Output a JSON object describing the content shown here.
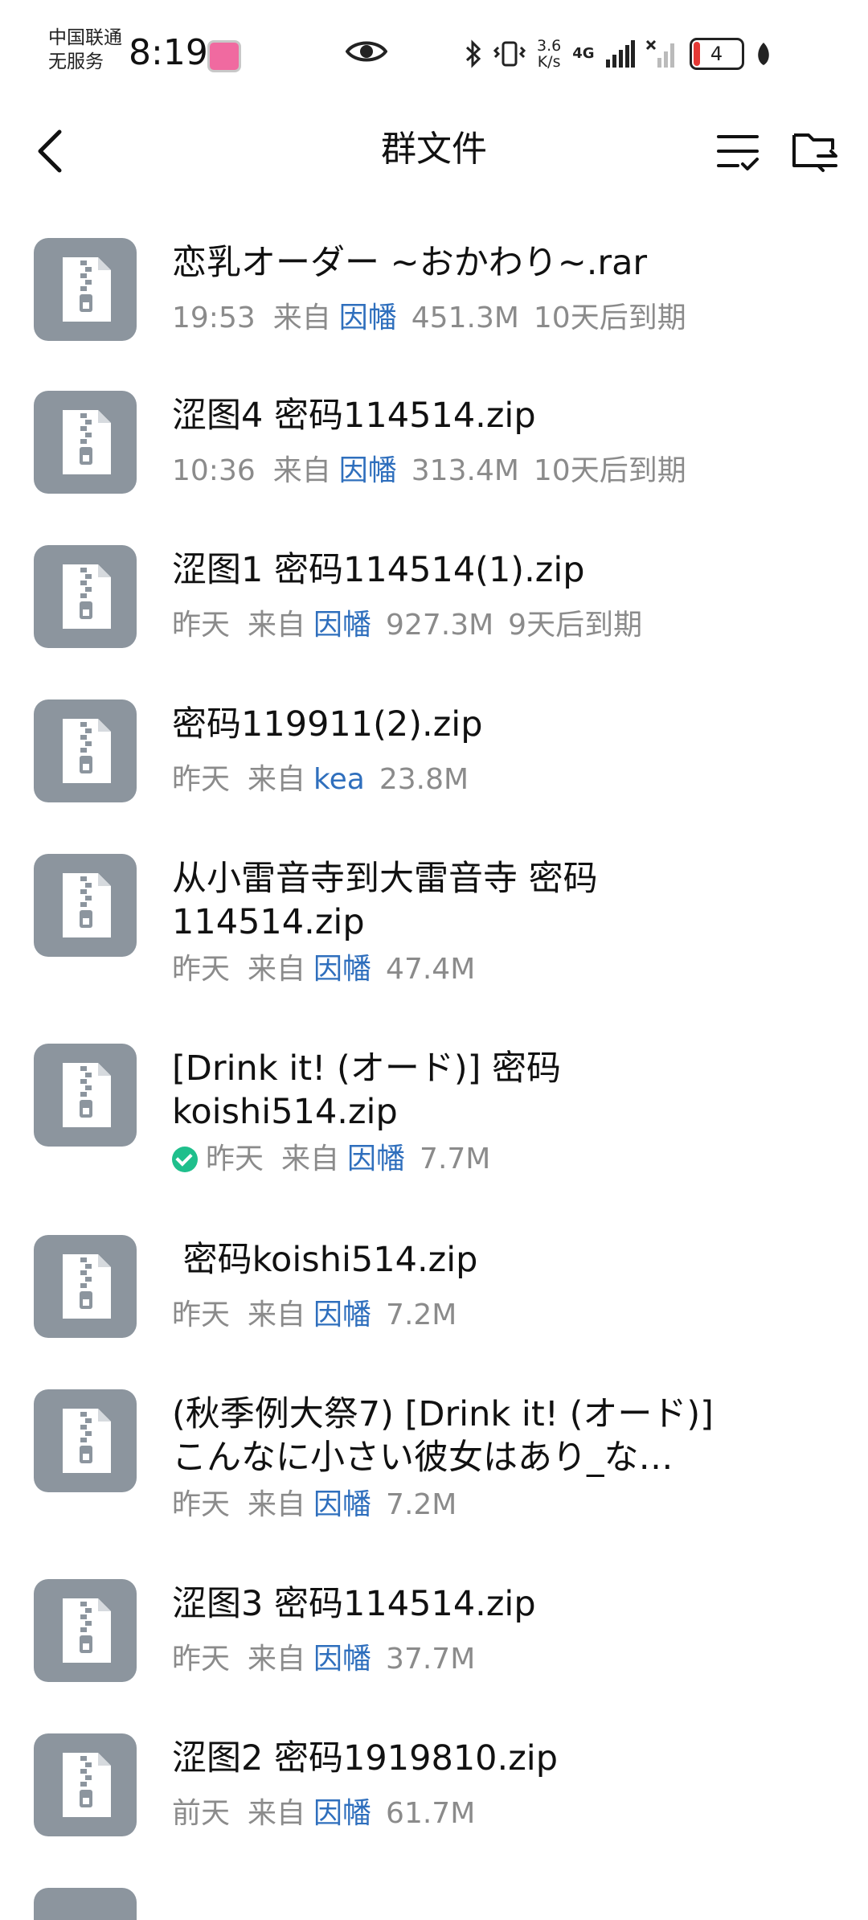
{
  "status_bar": {
    "carrier_line1": "中国联通",
    "carrier_line2": "无服务",
    "time": "8:19",
    "net_speed_value": "3.6",
    "net_speed_unit": "K/s",
    "network_type": "4G",
    "battery_level": "4"
  },
  "header": {
    "title": "群文件",
    "icons": [
      "back-icon",
      "sort-icon",
      "folder-transfer-icon"
    ]
  },
  "files": [
    {
      "name": "恋乳オーダー ~おかわり~.rar",
      "time": "19:53",
      "from_label": "来自",
      "sender": "因幡",
      "size": "451.3M",
      "expiry": "10天后到期",
      "downloaded": false
    },
    {
      "name": "涩图4 密码114514.zip",
      "time": "10:36",
      "from_label": "来自",
      "sender": "因幡",
      "size": "313.4M",
      "expiry": "10天后到期",
      "downloaded": false
    },
    {
      "name": "涩图1 密码114514(1).zip",
      "time": "昨天",
      "from_label": "来自",
      "sender": "因幡",
      "size": "927.3M",
      "expiry": "9天后到期",
      "downloaded": false
    },
    {
      "name": "密码119911(2).zip",
      "time": "昨天",
      "from_label": "来自",
      "sender": "kea",
      "size": "23.8M",
      "expiry": "",
      "downloaded": false
    },
    {
      "name": "从小雷音寺到大雷音寺 密码114514.zip",
      "time": "昨天",
      "from_label": "来自",
      "sender": "因幡",
      "size": "47.4M",
      "expiry": "",
      "downloaded": false
    },
    {
      "name": "[Drink it! (オード)] 密码koishi514.zip",
      "time": "昨天",
      "from_label": "来自",
      "sender": "因幡",
      "size": "7.7M",
      "expiry": "",
      "downloaded": true
    },
    {
      "name": " 密码koishi514.zip",
      "time": "昨天",
      "from_label": "来自",
      "sender": "因幡",
      "size": "7.2M",
      "expiry": "",
      "downloaded": false
    },
    {
      "name": "(秋季例大祭7) [Drink it! (オード)] こんなに小さい彼女はあり_な…",
      "time": "昨天",
      "from_label": "来自",
      "sender": "因幡",
      "size": "7.2M",
      "expiry": "",
      "downloaded": false
    },
    {
      "name": "涩图3 密码114514.zip",
      "time": "昨天",
      "from_label": "来自",
      "sender": "因幡",
      "size": "37.7M",
      "expiry": "",
      "downloaded": false
    },
    {
      "name": "涩图2 密码1919810.zip",
      "time": "前天",
      "from_label": "来自",
      "sender": "因幡",
      "size": "61.7M",
      "expiry": "",
      "downloaded": false
    }
  ]
}
